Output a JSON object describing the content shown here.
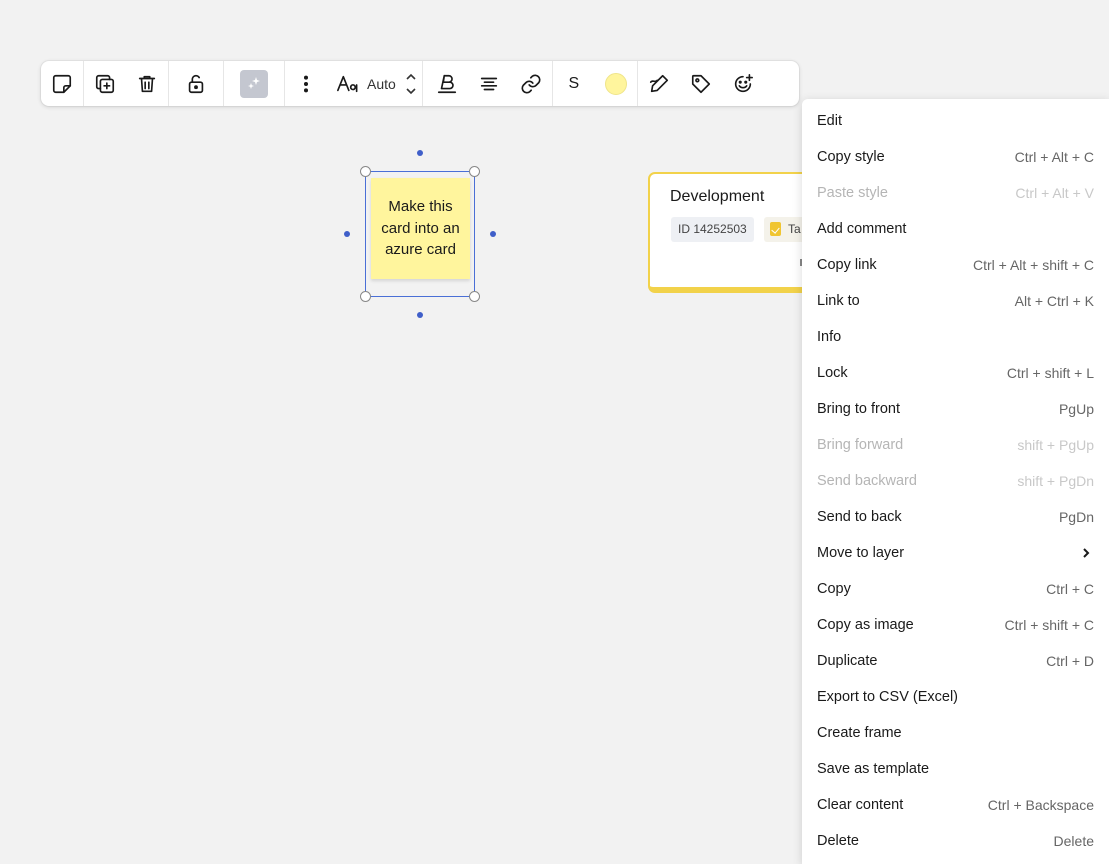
{
  "toolbar": {
    "buttons": [
      "sticky-note-icon",
      "duplicate-icon",
      "trash-icon",
      "unlock-icon",
      "ai-sparkle-icon",
      "more-vertical-icon",
      "font-size-icon",
      "font-stepper-icon",
      "bold-icon",
      "align-center-icon",
      "link-icon",
      "sticky-size-icon",
      "color-swatch-icon",
      "draw-icon",
      "tag-icon",
      "add-reaction-icon"
    ],
    "font_size_value": "Auto",
    "size_label": "S",
    "sticky_color": "#fff59d"
  },
  "canvas": {
    "sticky_text": "Make this card into an azure card",
    "dev_card": {
      "title": "Development",
      "id_label": "ID 14252503",
      "tag_label": "Ta"
    }
  },
  "context_menu": {
    "items": [
      {
        "label": "Edit",
        "shortcut": ""
      },
      {
        "label": "Copy style",
        "shortcut": "Ctrl + Alt + C"
      },
      {
        "label": "Paste style",
        "shortcut": "Ctrl + Alt + V",
        "disabled": true
      },
      {
        "label": "Add comment",
        "shortcut": ""
      },
      {
        "label": "Copy link",
        "shortcut": "Ctrl + Alt + shift + C"
      },
      {
        "label": "Link to",
        "shortcut": "Alt + Ctrl + K"
      },
      {
        "label": "Info",
        "shortcut": ""
      },
      {
        "label": "Lock",
        "shortcut": "Ctrl + shift + L"
      },
      {
        "label": "Bring to front",
        "shortcut": "PgUp"
      },
      {
        "label": "Bring forward",
        "shortcut": "shift + PgUp",
        "disabled": true
      },
      {
        "label": "Send backward",
        "shortcut": "shift + PgDn",
        "disabled": true
      },
      {
        "label": "Send to back",
        "shortcut": "PgDn"
      },
      {
        "label": "Move to layer",
        "shortcut": "",
        "submenu": true
      },
      {
        "label": "Copy",
        "shortcut": "Ctrl + C"
      },
      {
        "label": "Copy as image",
        "shortcut": "Ctrl + shift + C"
      },
      {
        "label": "Duplicate",
        "shortcut": "Ctrl + D"
      },
      {
        "label": "Export to CSV (Excel)",
        "shortcut": ""
      },
      {
        "label": "Create frame",
        "shortcut": ""
      },
      {
        "label": "Save as template",
        "shortcut": ""
      },
      {
        "label": "Clear content",
        "shortcut": "Ctrl + Backspace"
      },
      {
        "label": "Delete",
        "shortcut": "Delete"
      }
    ]
  }
}
